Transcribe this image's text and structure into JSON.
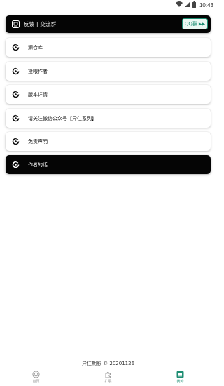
{
  "status_bar": {
    "time": "10:43"
  },
  "header": {
    "title": "反馈 | 交流群",
    "qq_button_label": "QQ群"
  },
  "menu_items": [
    {
      "label": "源仓库"
    },
    {
      "label": "投喂作者"
    },
    {
      "label": "版本详情"
    },
    {
      "label": "请关注微信公众号【异仁系列】"
    },
    {
      "label": "免责声明"
    }
  ],
  "author_card": {
    "label": "作者的话"
  },
  "footer": {
    "text": "异仁期影 © 20201126"
  },
  "bottom_nav": [
    {
      "label": "首页",
      "icon": "home-icon",
      "active": false
    },
    {
      "label": "扩展",
      "icon": "puzzle-icon",
      "active": false
    },
    {
      "label": "我的",
      "icon": "profile-icon",
      "active": true
    }
  ],
  "colors": {
    "accent": "#1e8e73",
    "dark_card": "#050505",
    "background": "#ffffff"
  }
}
